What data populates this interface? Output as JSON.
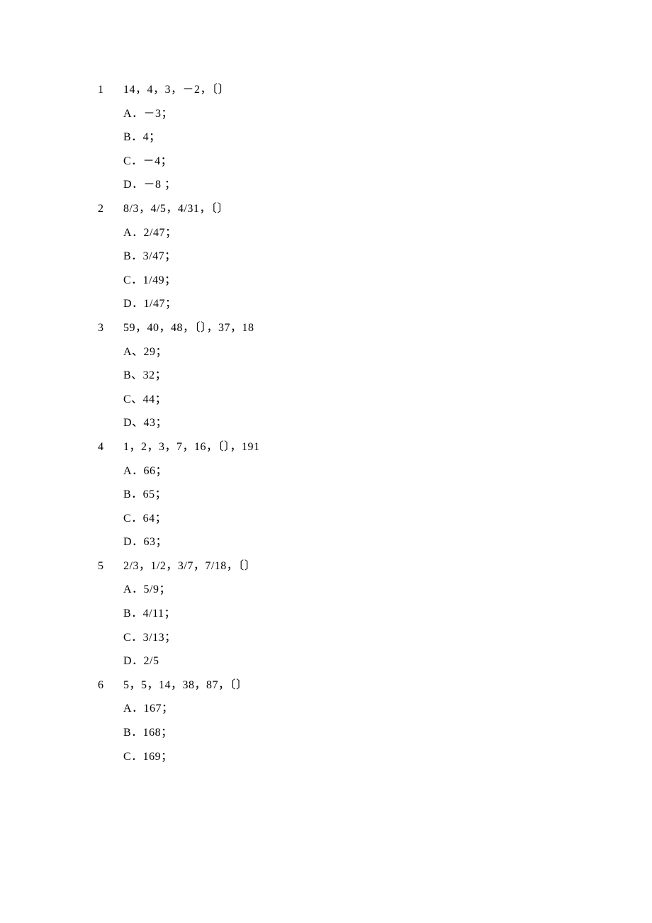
{
  "questions": [
    {
      "num": "1",
      "stem": "14，4，3，－2，〔〕",
      "options": [
        "A．－3；",
        "B．4；",
        "C．－4；",
        "D．－8 ；"
      ]
    },
    {
      "num": "2",
      "stem": "8/3，4/5，4/31，〔〕",
      "options": [
        "A．2/47；",
        "B．3/47；",
        "C．1/49；",
        "D．1/47；"
      ]
    },
    {
      "num": "3",
      "stem": "59，40，48，〔〕，37，18",
      "options": [
        "A、29；",
        "B、32；",
        "C、44；",
        "D、43；"
      ]
    },
    {
      "num": "4",
      "stem": "1，2，3，7，16，〔〕，191",
      "options": [
        "A．66；",
        "B．65；",
        "C．64；",
        "D．63；"
      ]
    },
    {
      "num": "5",
      "stem": "2/3，1/2，3/7，7/18，〔〕",
      "options": [
        "A．5/9；",
        "B．4/11；",
        "C．3/13；",
        "D．2/5"
      ]
    },
    {
      "num": "6",
      "stem": "5，5，14，38，87，〔〕",
      "options": [
        "A．167；",
        "B．168；",
        "C．169；"
      ]
    }
  ]
}
